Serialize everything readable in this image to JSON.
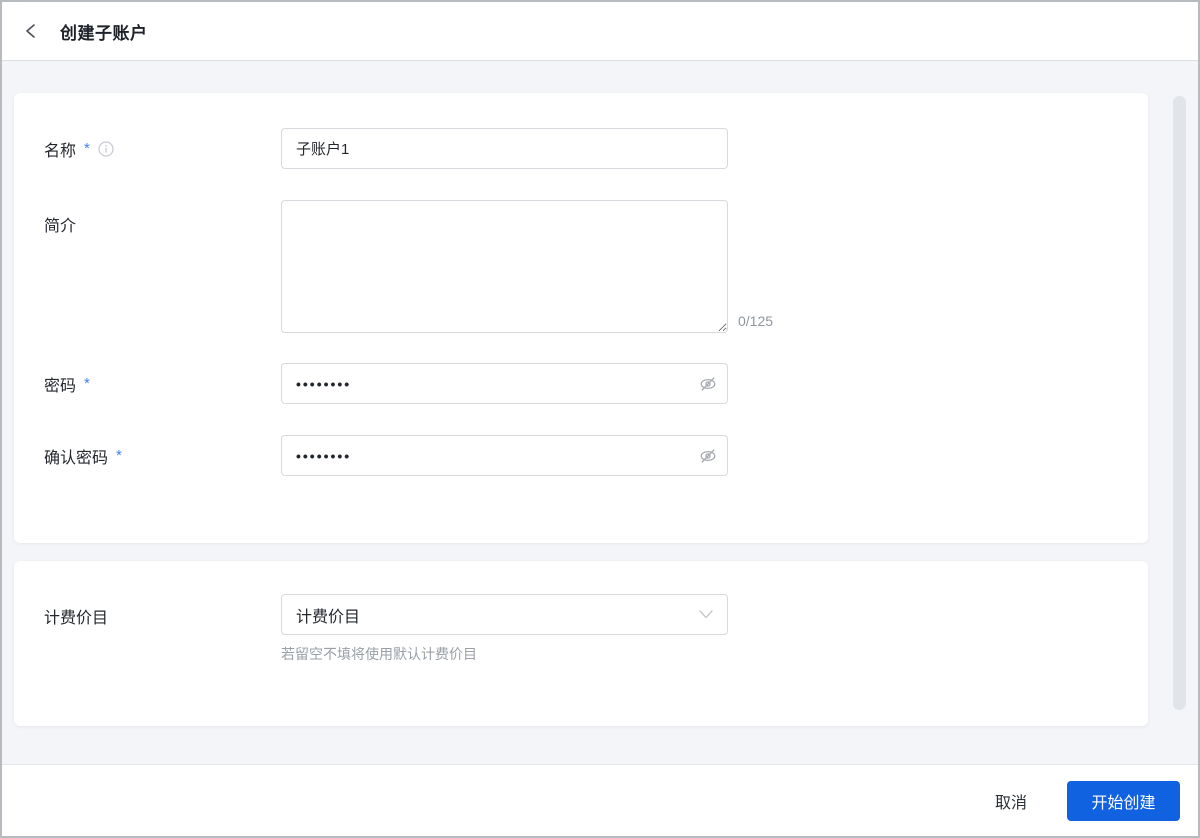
{
  "header": {
    "title": "创建子账户"
  },
  "form": {
    "name": {
      "label": "名称",
      "required_mark": "*",
      "value": "子账户1"
    },
    "intro": {
      "label": "简介",
      "value": "",
      "counter": "0/125"
    },
    "password": {
      "label": "密码",
      "required_mark": "*",
      "value": "••••••••"
    },
    "confirm_password": {
      "label": "确认密码",
      "required_mark": "*",
      "value": "••••••••"
    }
  },
  "billing": {
    "label": "计费价目",
    "value": "计费价目",
    "hint": "若留空不填将使用默认计费价目"
  },
  "footer": {
    "cancel_label": "取消",
    "submit_label": "开始创建"
  },
  "colors": {
    "primary_blue": "#1062e0",
    "asterisk_blue": "#3e82f0",
    "page_background": "#f4f5f8"
  },
  "icons": {
    "back": "back-chevron",
    "name_info": "info-circle",
    "password_visibility": "eye-slash",
    "billing_dropdown": "chevron-down"
  }
}
